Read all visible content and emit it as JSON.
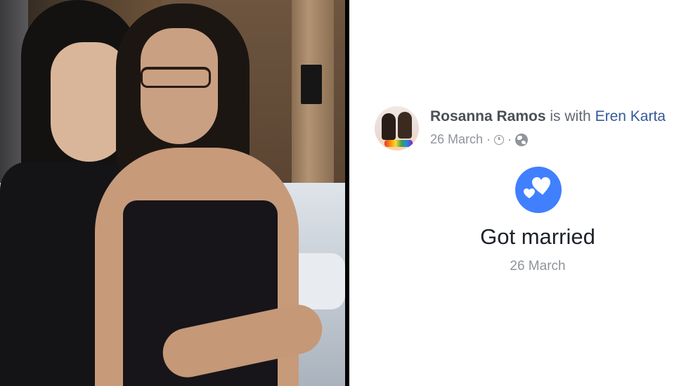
{
  "post": {
    "author": "Rosanna Ramos",
    "with_text": "is with",
    "tagged": "Eren Karta",
    "date": "26 March",
    "separator": "·",
    "icons": [
      "clock-icon",
      "globe-icon",
      "hearts-icon"
    ],
    "life_event": {
      "title": "Got married",
      "date": "26 March",
      "icon_color": "#4080ff"
    }
  }
}
